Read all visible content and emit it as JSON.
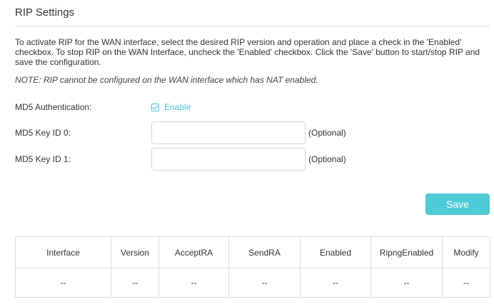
{
  "section": {
    "title": "RIP Settings",
    "description": "To activate RIP for the WAN interface, select the desired RIP version and operation and place a check in the 'Enabled' checkbox. To stop RIP on the WAN Interface, uncheck the 'Enabled' checkbox. Click the 'Save' button to start/stop RIP and save the configuration.",
    "note": "NOTE: RIP cannot be configured on the WAN interface which has NAT enabled."
  },
  "form": {
    "md5_auth_label": "MD5 Authentication:",
    "md5_auth_checkbox_label": "Enable",
    "md5_auth_checked": true,
    "key0_label": "MD5 Key ID 0:",
    "key0_value": "",
    "key0_hint": "(Optional)",
    "key1_label": "MD5 Key ID 1:",
    "key1_value": "",
    "key1_hint": "(Optional)",
    "save_label": "Save"
  },
  "table": {
    "headers": [
      "Interface",
      "Version",
      "AcceptRA",
      "SendRA",
      "Enabled",
      "RipngEnabled",
      "Modify"
    ],
    "rows": [
      [
        "--",
        "--",
        "--",
        "--",
        "--",
        "--",
        "--"
      ]
    ]
  },
  "colors": {
    "accent": "#4bc1d2",
    "save_button": "#4ecbd6",
    "border": "#dcdcdc"
  },
  "icons": {
    "checkbox": "checkmark-icon"
  }
}
